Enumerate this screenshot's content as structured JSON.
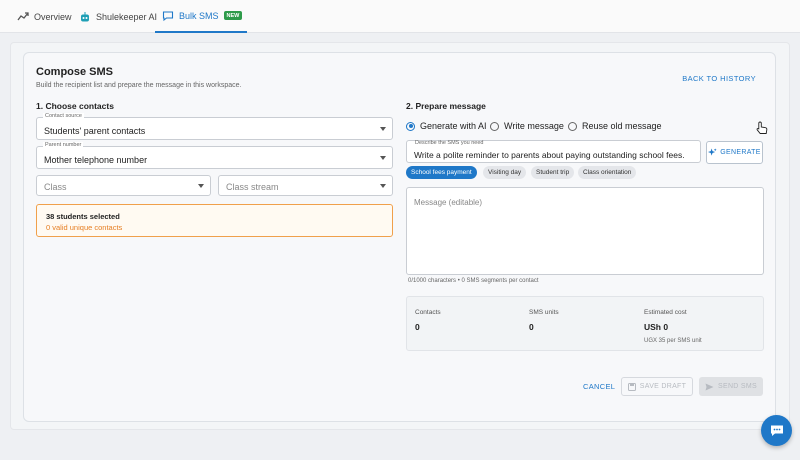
{
  "tabs": [
    {
      "label": "Overview",
      "icon": "trend-line-icon"
    },
    {
      "label": "Shulekeeper AI",
      "icon": "robot-icon"
    },
    {
      "label": "Bulk SMS",
      "icon": "chat-icon",
      "badge": "NEW"
    }
  ],
  "compose": {
    "title": "Compose SMS",
    "subtitle": "Build the recipient list and prepare the message in this workspace.",
    "back_link": "BACK TO HISTORY"
  },
  "contacts": {
    "heading": "1. Choose contacts",
    "contact_source": {
      "label": "Contact source",
      "value": "Students' parent contacts"
    },
    "parent_number": {
      "label": "Parent number",
      "value": "Mother telephone number"
    },
    "class_placeholder": "Class",
    "stream_placeholder": "Class stream",
    "selected_count": "38 students selected",
    "valid_contacts": "0 valid unique contacts"
  },
  "message": {
    "heading": "2. Prepare message",
    "modes": [
      {
        "label": "Generate with AI",
        "selected": true
      },
      {
        "label": "Write message",
        "selected": false
      },
      {
        "label": "Reuse old message",
        "selected": false
      }
    ],
    "describe_label": "Describe the SMS you need",
    "describe_value": "Write a polite reminder to parents about paying outstanding school fees.",
    "generate_label": "GENERATE",
    "chips": [
      {
        "label": "School fees payment",
        "selected": true
      },
      {
        "label": "Visiting day",
        "selected": false
      },
      {
        "label": "Student trip",
        "selected": false
      },
      {
        "label": "Class orientation",
        "selected": false
      }
    ],
    "editable_placeholder": "Message (editable)",
    "counter": "0/1000 characters • 0 SMS segments per contact"
  },
  "stats": {
    "contacts_label": "Contacts",
    "contacts_value": "0",
    "units_label": "SMS units",
    "units_value": "0",
    "cost_label": "Estimated cost",
    "cost_value": "USh 0",
    "cost_note": "UGX 35 per SMS unit"
  },
  "actions": {
    "cancel": "CANCEL",
    "save_draft": "SAVE DRAFT",
    "send": "SEND SMS"
  },
  "colors": {
    "accent": "#1f78c8",
    "warning": "#e67e22",
    "badge_green": "#2e9b4a"
  }
}
